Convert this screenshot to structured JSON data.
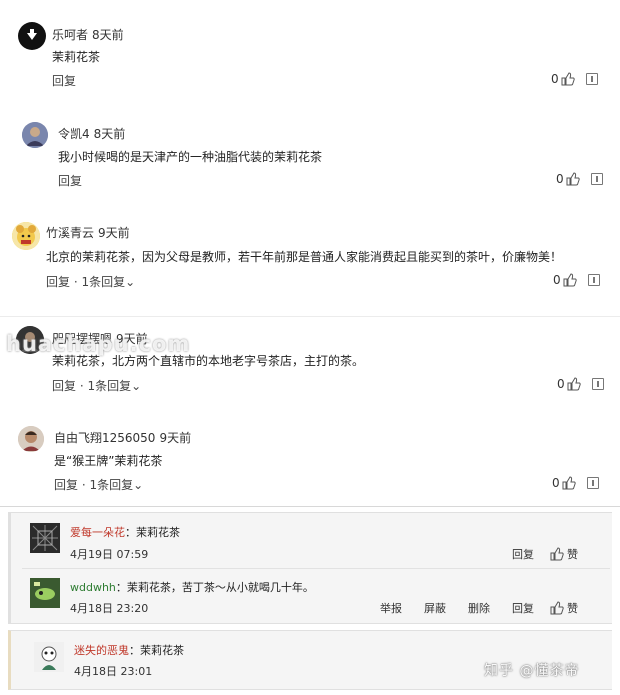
{
  "comments": [
    {
      "author": "乐呵者",
      "time": "8天前",
      "content": "茉莉花茶",
      "reply": "回复",
      "likes": "0"
    },
    {
      "author": "令凯4",
      "time": "8天前",
      "content": "我小时候喝的是天津产的一种油脂代装的茉莉花茶",
      "reply": "回复",
      "likes": "0"
    },
    {
      "author": "竹溪青云",
      "time": "9天前",
      "content": "北京的茉莉花茶，因为父母是教师，若干年前那是普通人家能消费起且能买到的茶叶，价廉物美！",
      "reply": "回复",
      "sep": " · ",
      "replies": "1条回复",
      "likes": "0"
    },
    {
      "author": "咫咫摆摆嗯",
      "time": "9天前",
      "content": "茉莉花茶，北方两个直辖市的本地老字号茶店，主打的茶。",
      "reply": "回复",
      "sep": " · ",
      "replies": "1条回复",
      "likes": "0"
    },
    {
      "author": "自由飞翔1256050",
      "time": "9天前",
      "content": "是“猴王牌”茉莉花茶",
      "reply": "回复",
      "sep": " · ",
      "replies": "1条回复",
      "likes": "0"
    }
  ],
  "sub_replies": [
    {
      "name": "爱每一朵花",
      "text": "：茉莉花茶",
      "time": "4月19日 07:59",
      "reply": "回复",
      "like": "赞"
    },
    {
      "name": "wddwhh",
      "text": "：茉莉花茶，苦丁茶～从小就喝几十年。",
      "time": "4月18日 23:20",
      "report": "举报",
      "block": "屏蔽",
      "delete": "删除",
      "reply": "回复",
      "like": "赞"
    },
    {
      "name": "迷失的恶鬼",
      "text": "：茉莉花茶",
      "time": "4月18日 23:01"
    }
  ],
  "watermark": "huachapu.com",
  "footer_watermark": "知乎 @懂茶帝",
  "colors": {
    "name_red": "#c0392b",
    "name_green": "#2e7d32",
    "text": "#222222"
  }
}
